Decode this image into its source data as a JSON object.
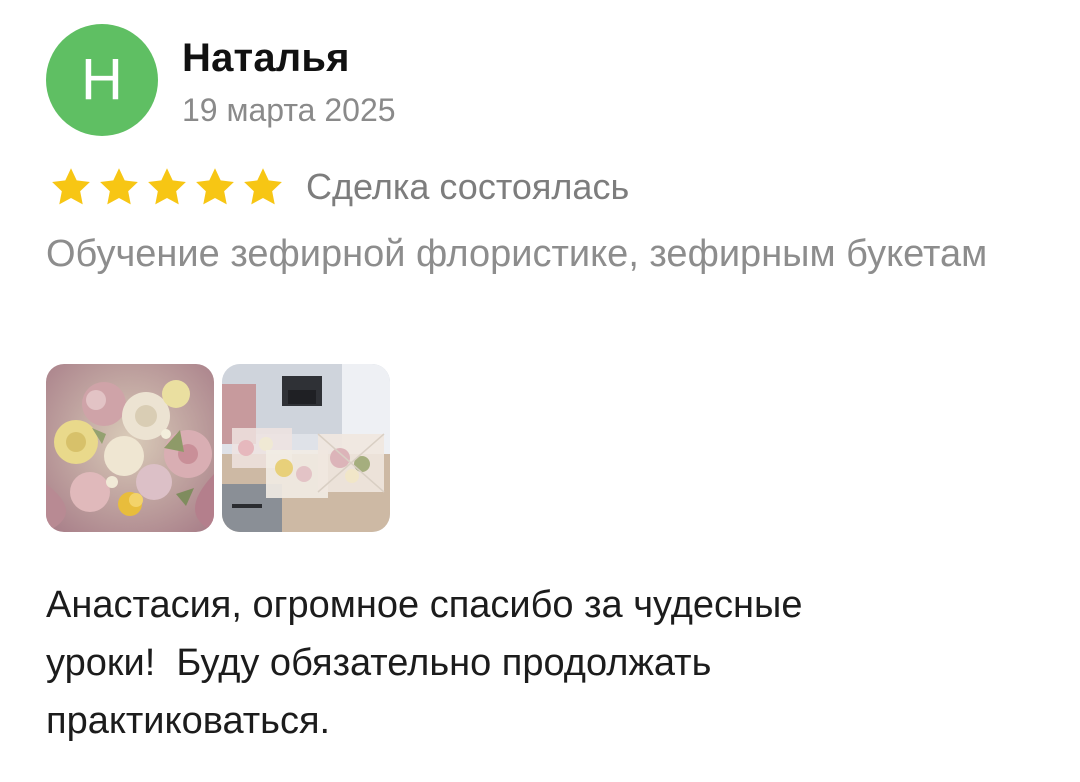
{
  "review": {
    "avatar_letter": "Н",
    "avatar_color": "#5fbf63",
    "author_name": "Наталья",
    "date": "19 марта 2025",
    "rating": 5,
    "rating_max": 5,
    "star_color": "#f7c614",
    "deal_status": "Сделка состоялась",
    "service_title": "Обучение зефирной флористике, зефирным букетам",
    "photos": [
      {
        "subject": "marshmallow flower bouquet close-up"
      },
      {
        "subject": "marshmallow bouquets in clear boxes on a table"
      }
    ],
    "text": "Анастасия, огромное спасибо за чудесные\nуроки!  Буду обязательно продолжать\nпрактиковаться."
  }
}
